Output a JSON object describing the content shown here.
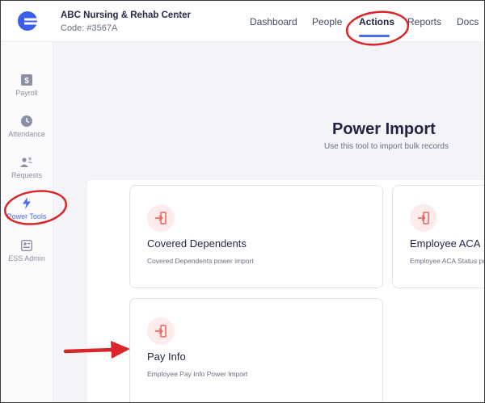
{
  "header": {
    "org_name": "ABC Nursing & Rehab Center",
    "org_code": "Code: #3567A",
    "nav": [
      {
        "label": "Dashboard"
      },
      {
        "label": "People"
      },
      {
        "label": "Actions"
      },
      {
        "label": "Reports"
      },
      {
        "label": "Docs"
      }
    ],
    "active_nav": "Actions"
  },
  "sidebar": {
    "items": [
      {
        "label": "Payroll",
        "icon": "dollar-icon"
      },
      {
        "label": "Attendance",
        "icon": "clock-icon"
      },
      {
        "label": "Requests",
        "icon": "people-icon"
      },
      {
        "label": "Power Tools",
        "icon": "lightning-icon"
      },
      {
        "label": "ESS Admin",
        "icon": "badge-icon"
      }
    ],
    "active": "Power Tools"
  },
  "main": {
    "title": "Power Import",
    "subtitle": "Use this tool to import bulk records",
    "cards": [
      {
        "title": "Covered Dependents",
        "description": "Covered Dependents power import",
        "icon": "import-icon"
      },
      {
        "title": "Employee ACA",
        "description": "Employee ACA Status power import",
        "icon": "import-icon"
      },
      {
        "title": "Pay Info",
        "description": "Employee Pay Info Power Import",
        "icon": "import-icon"
      }
    ]
  },
  "colors": {
    "accent": "#4a6cf0",
    "annotation_red": "#d9262b",
    "icon_red": "#e8635c",
    "icon_bg": "#fdeceb",
    "title_navy": "#1f2444"
  }
}
